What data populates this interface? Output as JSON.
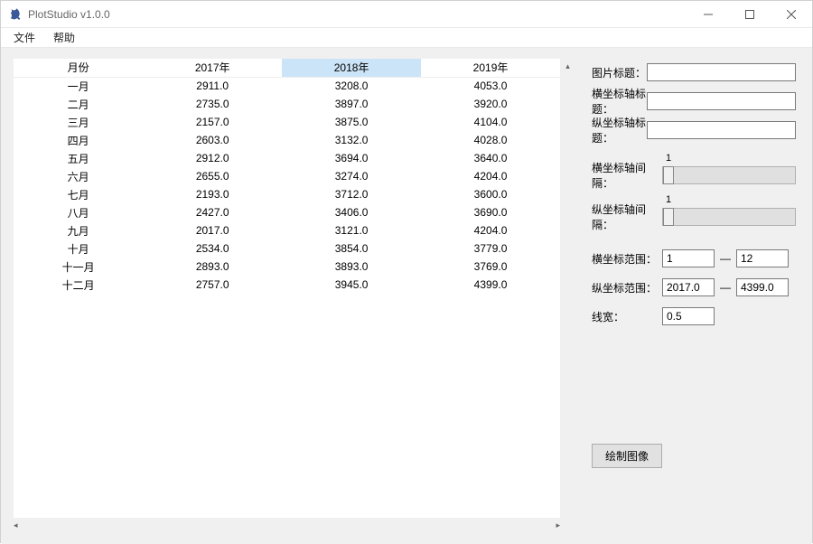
{
  "window": {
    "title": "PlotStudio v1.0.0"
  },
  "menu": {
    "file": "文件",
    "help": "帮助"
  },
  "table": {
    "headers": [
      "月份",
      "2017年",
      "2018年",
      "2019年"
    ],
    "selected_header_index": 2,
    "rows": [
      [
        "一月",
        "2911.0",
        "3208.0",
        "4053.0"
      ],
      [
        "二月",
        "2735.0",
        "3897.0",
        "3920.0"
      ],
      [
        "三月",
        "2157.0",
        "3875.0",
        "4104.0"
      ],
      [
        "四月",
        "2603.0",
        "3132.0",
        "4028.0"
      ],
      [
        "五月",
        "2912.0",
        "3694.0",
        "3640.0"
      ],
      [
        "六月",
        "2655.0",
        "3274.0",
        "4204.0"
      ],
      [
        "七月",
        "2193.0",
        "3712.0",
        "3600.0"
      ],
      [
        "八月",
        "2427.0",
        "3406.0",
        "3690.0"
      ],
      [
        "九月",
        "2017.0",
        "3121.0",
        "4204.0"
      ],
      [
        "十月",
        "2534.0",
        "3854.0",
        "3779.0"
      ],
      [
        "十一月",
        "2893.0",
        "3893.0",
        "3769.0"
      ],
      [
        "十二月",
        "2757.0",
        "3945.0",
        "4399.0"
      ]
    ]
  },
  "form": {
    "image_title_label": "图片标题：",
    "image_title_value": "",
    "x_title_label": "横坐标轴标题：",
    "x_title_value": "",
    "y_title_label": "纵坐标轴标题：",
    "y_title_value": "",
    "x_interval_label": "横坐标轴间隔：",
    "x_interval_value": "1",
    "y_interval_label": "纵坐标轴间隔：",
    "y_interval_value": "1",
    "x_range_label": "横坐标范围：",
    "x_range_min": "1",
    "x_range_max": "12",
    "y_range_label": "纵坐标范围：",
    "y_range_min": "2017.0",
    "y_range_max": "4399.0",
    "linewidth_label": "线宽：",
    "linewidth_value": "0.5",
    "range_sep": "—",
    "draw_button": "绘制图像"
  }
}
